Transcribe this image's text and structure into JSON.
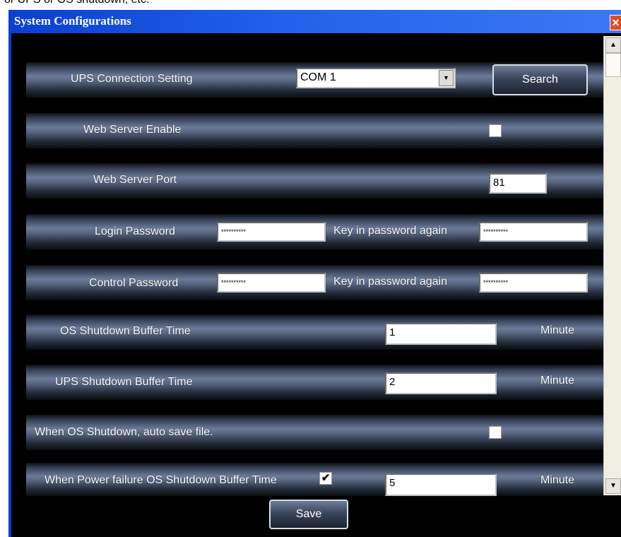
{
  "top_strip_text": "or UPS or OS shutdown, etc.",
  "window": {
    "title": "System Configurations",
    "close_glyph": "✕"
  },
  "ups_connection": {
    "label": "UPS Connection Setting",
    "port_value": "COM 1",
    "search_label": "Search"
  },
  "web_server_enable": {
    "label": "Web Server Enable",
    "checked": false
  },
  "web_server_port": {
    "label": "Web Server Port",
    "value": "81"
  },
  "login_password": {
    "label": "Login Password",
    "value": "**********",
    "confirm_label": "Key in password again",
    "confirm_value": "**********"
  },
  "control_password": {
    "label": "Control Password",
    "value": "**********",
    "confirm_label": "Key in password again",
    "confirm_value": "**********"
  },
  "os_shutdown_buffer": {
    "label": "OS Shutdown Buffer Time",
    "value": "1",
    "unit": "Minute"
  },
  "ups_shutdown_buffer": {
    "label": "UPS Shutdown Buffer Time",
    "value": "2",
    "unit": "Minute"
  },
  "auto_save": {
    "label": "When OS Shutdown, auto save file.",
    "checked": false
  },
  "power_failure_buffer": {
    "label": "When Power failure OS Shutdown Buffer Time",
    "checked": true,
    "check_glyph": "✔",
    "value": "5",
    "unit": "Minute"
  },
  "save_label": "Save",
  "icons": {
    "combo_arrow": "▼",
    "scroll_up": "▲",
    "scroll_down": "▼"
  },
  "colors": {
    "titlebar": "#1f5ee8",
    "background": "#000000",
    "row_highlight": "#6a7b98"
  }
}
